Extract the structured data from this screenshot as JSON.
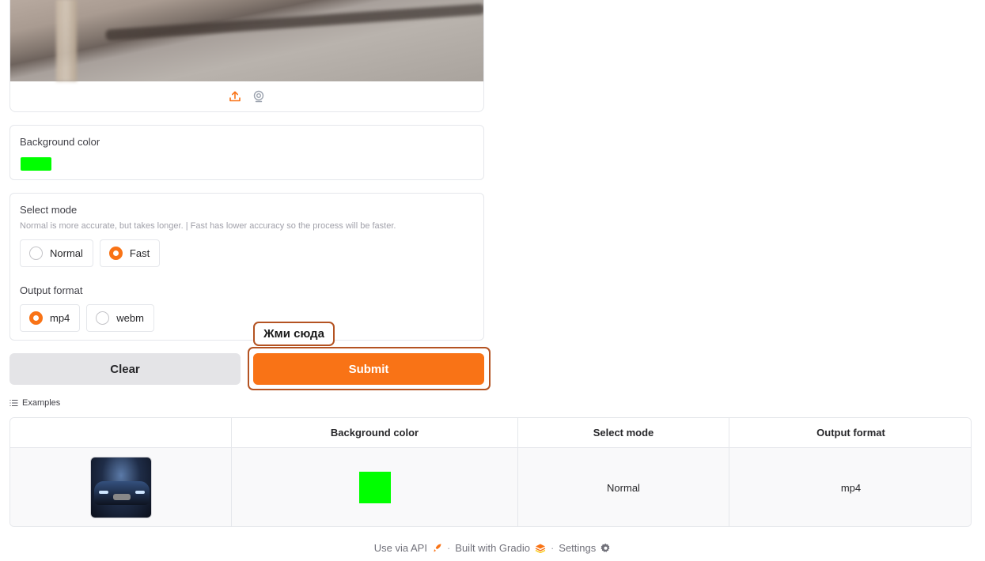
{
  "video": {
    "upload_icon": "upload-icon",
    "webcam_icon": "webcam-icon"
  },
  "background_color": {
    "label": "Background color",
    "value": "#00ff00"
  },
  "mode": {
    "label": "Select mode",
    "info": "Normal is more accurate, but takes longer. | Fast has lower accuracy so the process will be faster.",
    "options": [
      "Normal",
      "Fast"
    ],
    "selected": "Fast"
  },
  "output_format": {
    "label": "Output format",
    "options": [
      "mp4",
      "webm"
    ],
    "selected": "mp4"
  },
  "buttons": {
    "clear": "Clear",
    "submit": "Submit"
  },
  "tooltip": "Жми сюда",
  "accent_color": "#f97316",
  "examples": {
    "label": "Examples",
    "headers": [
      "",
      "Background color",
      "Select mode",
      "Output format"
    ],
    "rows": [
      {
        "thumbnail": "car-thumbnail",
        "background_color": "#00ff00",
        "mode": "Normal",
        "format": "mp4"
      }
    ]
  },
  "footer": {
    "api": "Use via API",
    "built": "Built with Gradio",
    "settings": "Settings",
    "separator": "·"
  }
}
